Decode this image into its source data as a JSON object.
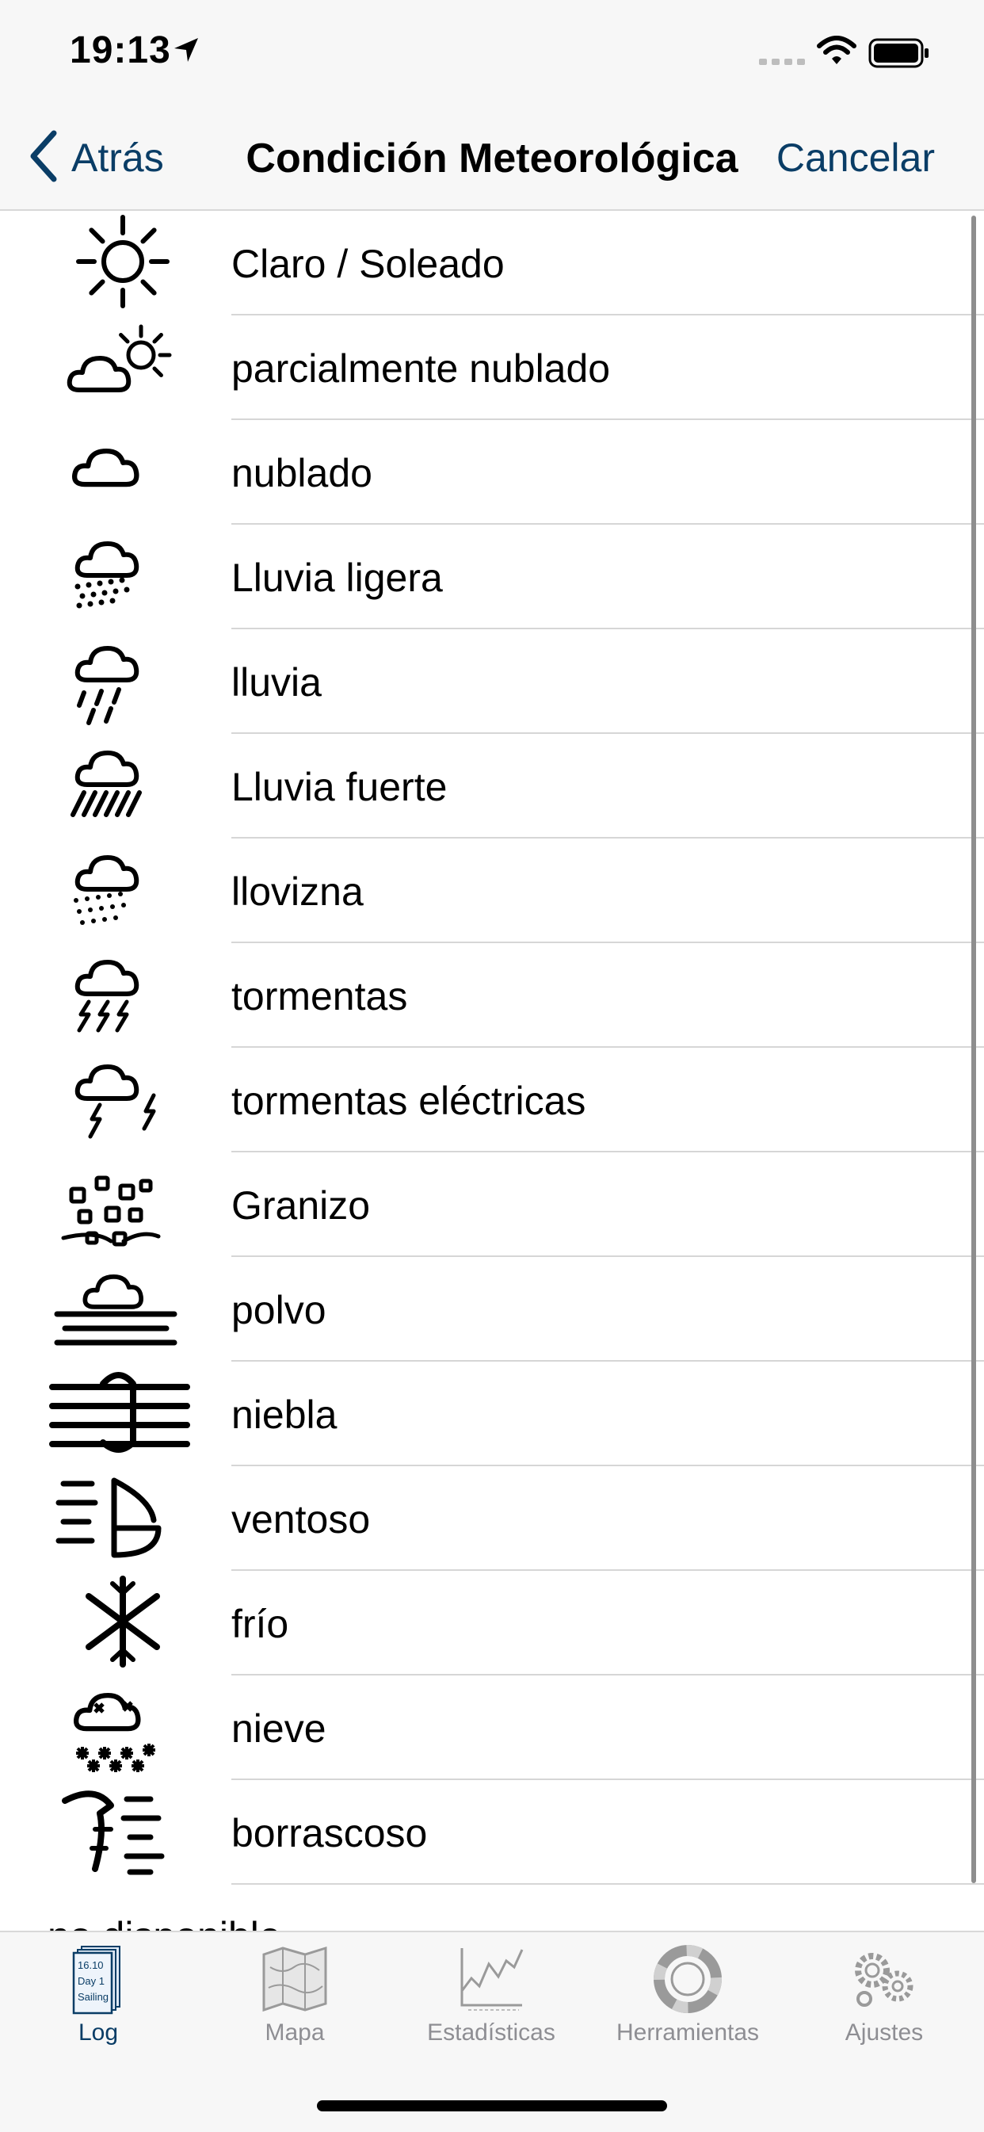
{
  "status_bar": {
    "time": "19:13"
  },
  "nav": {
    "back_label": "Atrás",
    "title": "Condición Meteorológica",
    "cancel_label": "Cancelar"
  },
  "conditions": [
    {
      "label": "Claro / Soleado",
      "icon": "sun-icon"
    },
    {
      "label": "parcialmente nublado",
      "icon": "partly-cloudy-icon"
    },
    {
      "label": "nublado",
      "icon": "cloud-icon"
    },
    {
      "label": "Lluvia ligera",
      "icon": "light-rain-icon"
    },
    {
      "label": "lluvia",
      "icon": "rain-icon"
    },
    {
      "label": "Lluvia fuerte",
      "icon": "heavy-rain-icon"
    },
    {
      "label": "llovizna",
      "icon": "drizzle-icon"
    },
    {
      "label": "tormentas",
      "icon": "storm-icon"
    },
    {
      "label": "tormentas eléctricas",
      "icon": "thunderstorm-icon"
    },
    {
      "label": "Granizo",
      "icon": "hail-icon"
    },
    {
      "label": "polvo",
      "icon": "dust-icon"
    },
    {
      "label": "niebla",
      "icon": "fog-icon"
    },
    {
      "label": "ventoso",
      "icon": "windy-icon"
    },
    {
      "label": "frío",
      "icon": "cold-icon"
    },
    {
      "label": "nieve",
      "icon": "snow-icon"
    },
    {
      "label": "borrascoso",
      "icon": "squally-icon"
    }
  ],
  "partial_item": "no disponible",
  "tabs": [
    {
      "label": "Log",
      "icon": "logbook-icon",
      "active": true
    },
    {
      "label": "Mapa",
      "icon": "map-icon",
      "active": false
    },
    {
      "label": "Estadísticas",
      "icon": "statistics-icon",
      "active": false
    },
    {
      "label": "Herramientas",
      "icon": "lifebuoy-icon",
      "active": false
    },
    {
      "label": "Ajustes",
      "icon": "gears-icon",
      "active": false
    }
  ],
  "log_icon_text": [
    "16.10",
    "Day 1",
    "Sailing"
  ],
  "colors": {
    "accent": "#0a3d66",
    "inactive": "#8e8e93",
    "bar_bg": "#f7f7f7"
  }
}
